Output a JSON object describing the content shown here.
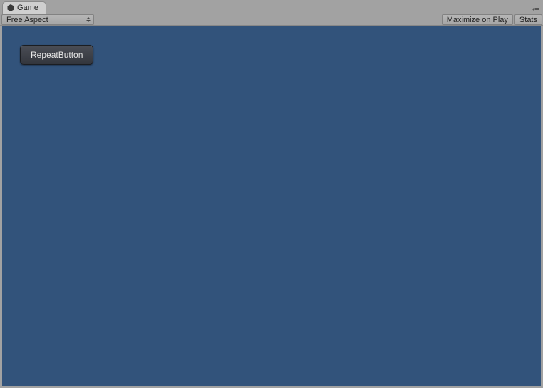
{
  "tab": {
    "label": "Game"
  },
  "toolbar": {
    "aspect_label": "Free Aspect",
    "maximize_label": "Maximize on Play",
    "stats_label": "Stats"
  },
  "game": {
    "repeat_button_label": "RepeatButton"
  },
  "colors": {
    "game_bg": "#32537b",
    "editor_bg": "#a2a2a2"
  }
}
